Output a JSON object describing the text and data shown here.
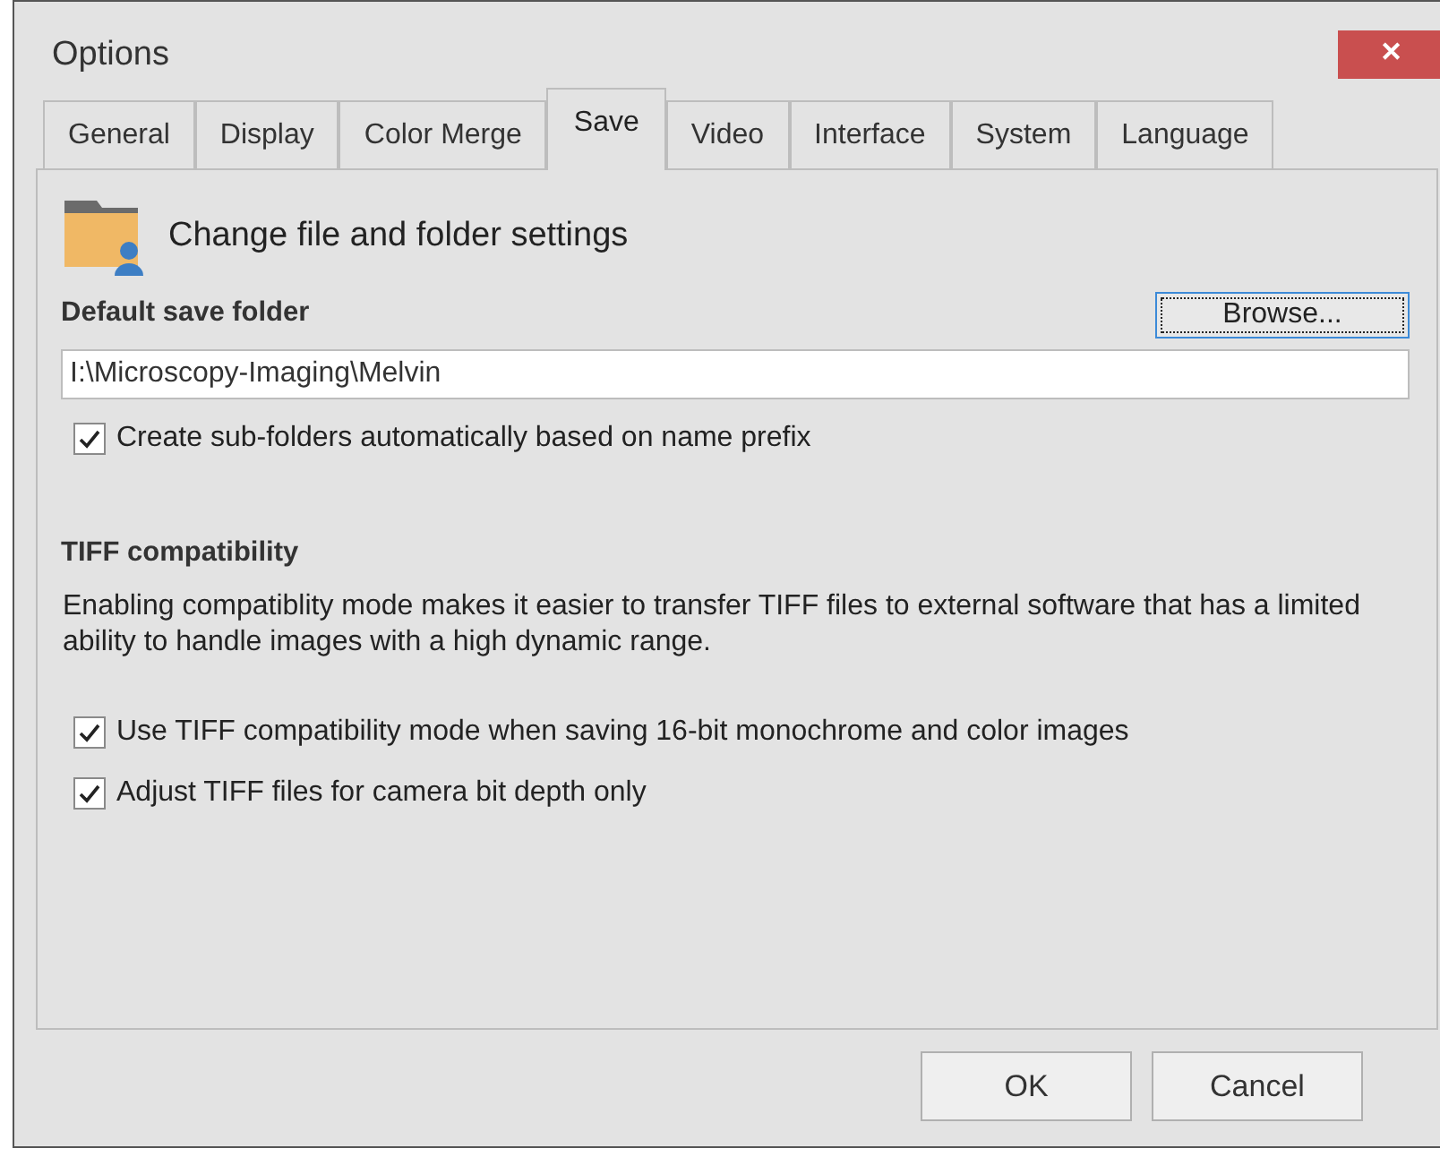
{
  "window": {
    "title": "Options",
    "close": "✕"
  },
  "tabs": [
    {
      "label": "General",
      "selected": false
    },
    {
      "label": "Display",
      "selected": false
    },
    {
      "label": "Color Merge",
      "selected": false
    },
    {
      "label": "Save",
      "selected": true
    },
    {
      "label": "Video",
      "selected": false
    },
    {
      "label": "Interface",
      "selected": false
    },
    {
      "label": "System",
      "selected": false
    },
    {
      "label": "Language",
      "selected": false
    }
  ],
  "header": "Change file and folder settings",
  "save_folder": {
    "label": "Default save folder",
    "browse": "Browse...",
    "value": "I:\\Microscopy-Imaging\\Melvin",
    "subfolders": {
      "label": "Create sub-folders automatically based on name prefix",
      "checked": true
    }
  },
  "tiff": {
    "label": "TIFF compatibility",
    "description": "Enabling compatiblity mode makes it easier to transfer TIFF files to external software that has a limited ability to handle images with a high dynamic range.",
    "options": [
      {
        "label": "Use TIFF compatibility mode when saving 16-bit monochrome and color images",
        "checked": true
      },
      {
        "label": "Adjust TIFF files for camera bit depth only",
        "checked": true
      }
    ]
  },
  "buttons": [
    "OK",
    "Cancel"
  ]
}
